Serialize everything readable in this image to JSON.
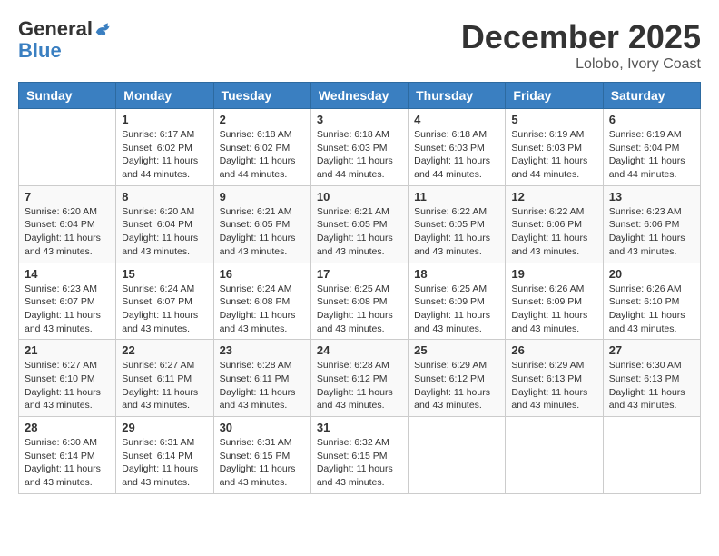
{
  "header": {
    "logo_general": "General",
    "logo_blue": "Blue",
    "month_title": "December 2025",
    "location": "Lolobo, Ivory Coast"
  },
  "calendar": {
    "days_of_week": [
      "Sunday",
      "Monday",
      "Tuesday",
      "Wednesday",
      "Thursday",
      "Friday",
      "Saturday"
    ],
    "weeks": [
      [
        {
          "day": "",
          "info": ""
        },
        {
          "day": "1",
          "info": "Sunrise: 6:17 AM\nSunset: 6:02 PM\nDaylight: 11 hours and 44 minutes."
        },
        {
          "day": "2",
          "info": "Sunrise: 6:18 AM\nSunset: 6:02 PM\nDaylight: 11 hours and 44 minutes."
        },
        {
          "day": "3",
          "info": "Sunrise: 6:18 AM\nSunset: 6:03 PM\nDaylight: 11 hours and 44 minutes."
        },
        {
          "day": "4",
          "info": "Sunrise: 6:18 AM\nSunset: 6:03 PM\nDaylight: 11 hours and 44 minutes."
        },
        {
          "day": "5",
          "info": "Sunrise: 6:19 AM\nSunset: 6:03 PM\nDaylight: 11 hours and 44 minutes."
        },
        {
          "day": "6",
          "info": "Sunrise: 6:19 AM\nSunset: 6:04 PM\nDaylight: 11 hours and 44 minutes."
        }
      ],
      [
        {
          "day": "7",
          "info": "Sunrise: 6:20 AM\nSunset: 6:04 PM\nDaylight: 11 hours and 43 minutes."
        },
        {
          "day": "8",
          "info": "Sunrise: 6:20 AM\nSunset: 6:04 PM\nDaylight: 11 hours and 43 minutes."
        },
        {
          "day": "9",
          "info": "Sunrise: 6:21 AM\nSunset: 6:05 PM\nDaylight: 11 hours and 43 minutes."
        },
        {
          "day": "10",
          "info": "Sunrise: 6:21 AM\nSunset: 6:05 PM\nDaylight: 11 hours and 43 minutes."
        },
        {
          "day": "11",
          "info": "Sunrise: 6:22 AM\nSunset: 6:05 PM\nDaylight: 11 hours and 43 minutes."
        },
        {
          "day": "12",
          "info": "Sunrise: 6:22 AM\nSunset: 6:06 PM\nDaylight: 11 hours and 43 minutes."
        },
        {
          "day": "13",
          "info": "Sunrise: 6:23 AM\nSunset: 6:06 PM\nDaylight: 11 hours and 43 minutes."
        }
      ],
      [
        {
          "day": "14",
          "info": "Sunrise: 6:23 AM\nSunset: 6:07 PM\nDaylight: 11 hours and 43 minutes."
        },
        {
          "day": "15",
          "info": "Sunrise: 6:24 AM\nSunset: 6:07 PM\nDaylight: 11 hours and 43 minutes."
        },
        {
          "day": "16",
          "info": "Sunrise: 6:24 AM\nSunset: 6:08 PM\nDaylight: 11 hours and 43 minutes."
        },
        {
          "day": "17",
          "info": "Sunrise: 6:25 AM\nSunset: 6:08 PM\nDaylight: 11 hours and 43 minutes."
        },
        {
          "day": "18",
          "info": "Sunrise: 6:25 AM\nSunset: 6:09 PM\nDaylight: 11 hours and 43 minutes."
        },
        {
          "day": "19",
          "info": "Sunrise: 6:26 AM\nSunset: 6:09 PM\nDaylight: 11 hours and 43 minutes."
        },
        {
          "day": "20",
          "info": "Sunrise: 6:26 AM\nSunset: 6:10 PM\nDaylight: 11 hours and 43 minutes."
        }
      ],
      [
        {
          "day": "21",
          "info": "Sunrise: 6:27 AM\nSunset: 6:10 PM\nDaylight: 11 hours and 43 minutes."
        },
        {
          "day": "22",
          "info": "Sunrise: 6:27 AM\nSunset: 6:11 PM\nDaylight: 11 hours and 43 minutes."
        },
        {
          "day": "23",
          "info": "Sunrise: 6:28 AM\nSunset: 6:11 PM\nDaylight: 11 hours and 43 minutes."
        },
        {
          "day": "24",
          "info": "Sunrise: 6:28 AM\nSunset: 6:12 PM\nDaylight: 11 hours and 43 minutes."
        },
        {
          "day": "25",
          "info": "Sunrise: 6:29 AM\nSunset: 6:12 PM\nDaylight: 11 hours and 43 minutes."
        },
        {
          "day": "26",
          "info": "Sunrise: 6:29 AM\nSunset: 6:13 PM\nDaylight: 11 hours and 43 minutes."
        },
        {
          "day": "27",
          "info": "Sunrise: 6:30 AM\nSunset: 6:13 PM\nDaylight: 11 hours and 43 minutes."
        }
      ],
      [
        {
          "day": "28",
          "info": "Sunrise: 6:30 AM\nSunset: 6:14 PM\nDaylight: 11 hours and 43 minutes."
        },
        {
          "day": "29",
          "info": "Sunrise: 6:31 AM\nSunset: 6:14 PM\nDaylight: 11 hours and 43 minutes."
        },
        {
          "day": "30",
          "info": "Sunrise: 6:31 AM\nSunset: 6:15 PM\nDaylight: 11 hours and 43 minutes."
        },
        {
          "day": "31",
          "info": "Sunrise: 6:32 AM\nSunset: 6:15 PM\nDaylight: 11 hours and 43 minutes."
        },
        {
          "day": "",
          "info": ""
        },
        {
          "day": "",
          "info": ""
        },
        {
          "day": "",
          "info": ""
        }
      ]
    ]
  }
}
